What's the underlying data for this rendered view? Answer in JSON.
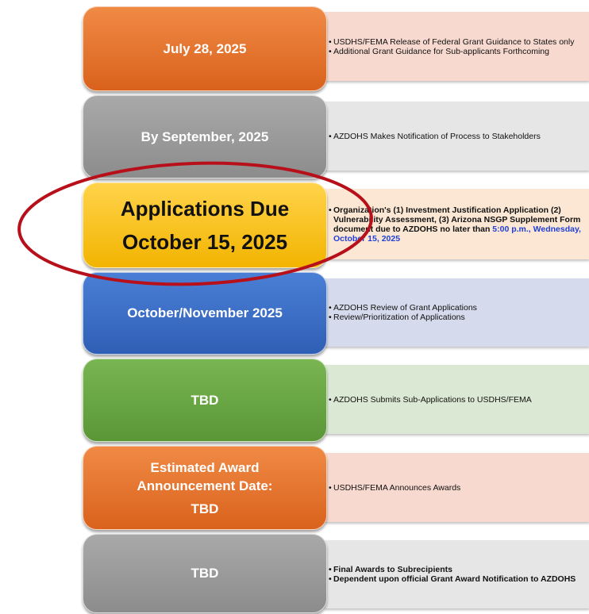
{
  "steps": [
    {
      "title": [
        "July 28, 2025"
      ],
      "pill_color": "#e8722a",
      "box_color": "#f7d9cf",
      "items": [
        "USDHS/FEMA Release of Federal Grant Guidance to States only",
        "Additional Grant Guidance for Sub-applicants Forthcoming"
      ]
    },
    {
      "title": [
        "By September, 2025"
      ],
      "pill_color": "#9a9a9a",
      "box_color": "#e6e6e6",
      "items": [
        "AZDOHS Makes Notification of Process to Stakeholders"
      ]
    },
    {
      "title": [
        "Applications Due",
        "October 15, 2025"
      ],
      "pill_color": "#ffc000",
      "box_color": "#fbe7d3",
      "items_prefix": "Organization's (1) Investment Justification Application (2) Vulnerability Assessment, (3) Arizona NSGP Supplement Form document due to AZDOHS no later than ",
      "items_highlight": "5:00 p.m., Wednesday, October 15, 2025"
    },
    {
      "title": [
        "October/November  2025"
      ],
      "pill_color": "#3e6fc8",
      "box_color": "#d5dbec",
      "items": [
        "AZDOHS Review of Grant Applications",
        "Review/Prioritization of Applications"
      ]
    },
    {
      "title": [
        "TBD"
      ],
      "pill_color": "#6aa843",
      "box_color": "#dbe8d4",
      "items": [
        "AZDOHS Submits Sub-Applications to USDHS/FEMA"
      ]
    },
    {
      "title": [
        "Estimated Award",
        "Announcement Date:",
        "TBD"
      ],
      "pill_color": "#e8722a",
      "box_color": "#f7d9cf",
      "items": [
        "USDHS/FEMA Announces Awards"
      ]
    },
    {
      "title": [
        "TBD"
      ],
      "pill_color": "#9a9a9a",
      "box_color": "#e6e6e6",
      "items": [
        "Final Awards to Subrecipients",
        "Dependent upon official Grant Award Notification to AZDOHS"
      ]
    }
  ],
  "highlight_ring_color": "#b8101a"
}
